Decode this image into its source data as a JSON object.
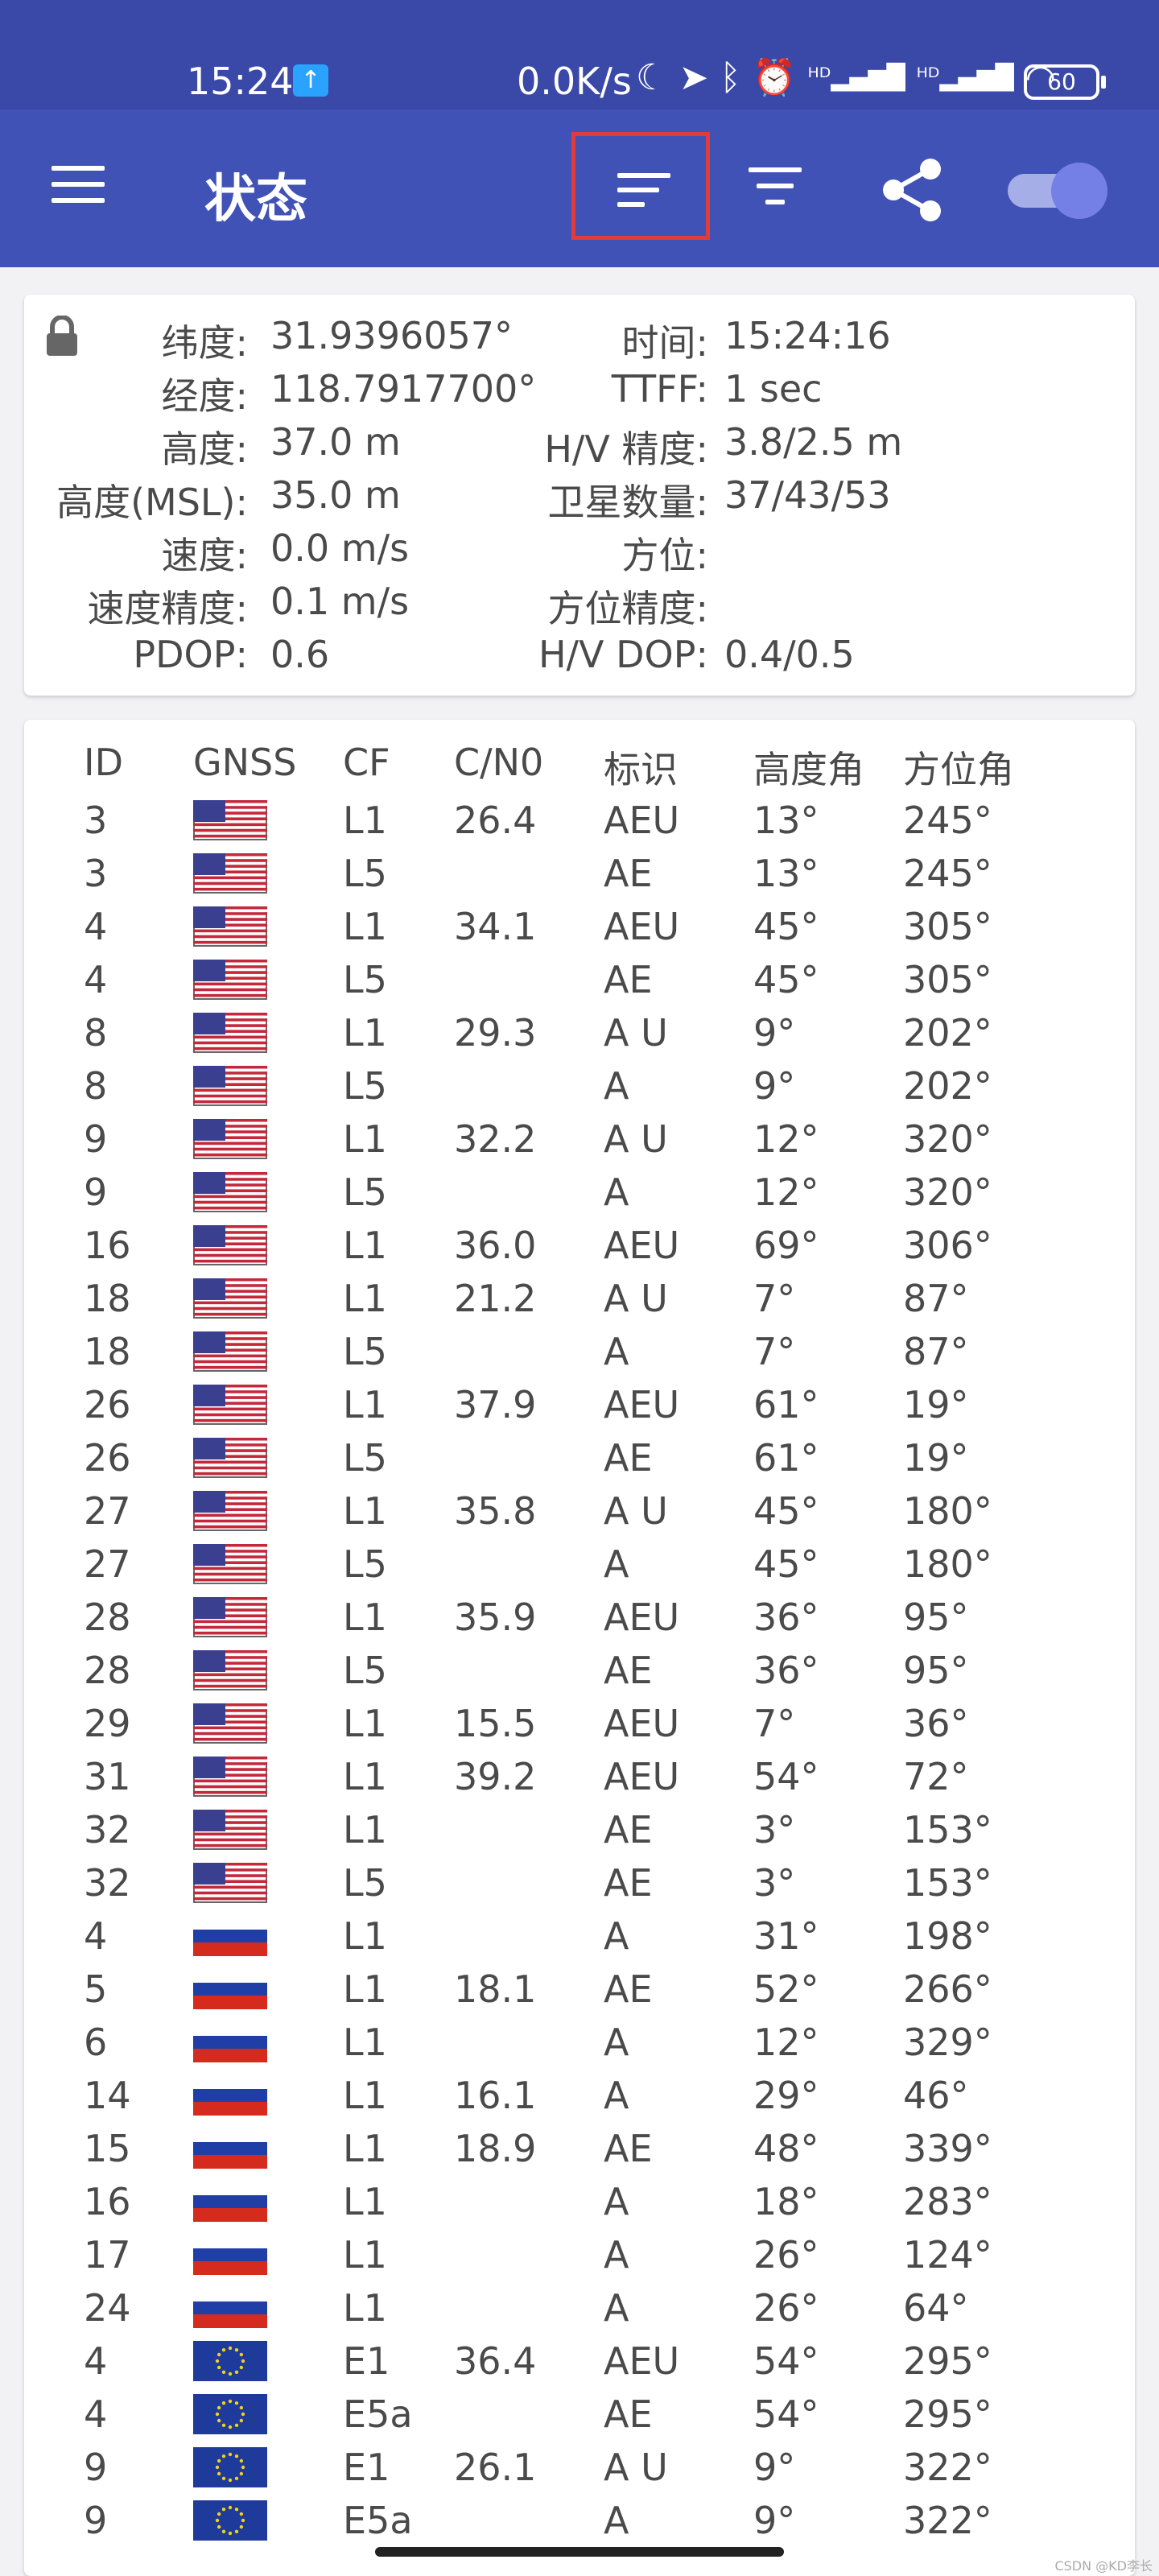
{
  "status_bar": {
    "time": "15:24",
    "speed": "0.0K/s",
    "battery": "60"
  },
  "appbar": {
    "title": "状态"
  },
  "info": {
    "rows": [
      {
        "l1": "纬度:",
        "v1": "31.9396057°",
        "l2": "时间:",
        "v2": "15:24:16"
      },
      {
        "l1": "经度:",
        "v1": "118.7917700°",
        "l2": "TTFF:",
        "v2": "1 sec"
      },
      {
        "l1": "高度:",
        "v1": "37.0 m",
        "l2": "H/V 精度:",
        "v2": "3.8/2.5 m"
      },
      {
        "l1": "高度(MSL):",
        "v1": "35.0 m",
        "l2": "卫星数量:",
        "v2": "37/43/53"
      },
      {
        "l1": "速度:",
        "v1": "0.0 m/s",
        "l2": "方位:",
        "v2": ""
      },
      {
        "l1": "速度精度:",
        "v1": "0.1 m/s",
        "l2": "方位精度:",
        "v2": ""
      },
      {
        "l1": "PDOP:",
        "v1": "0.6",
        "l2": "H/V DOP:",
        "v2": "0.4/0.5"
      }
    ]
  },
  "table": {
    "headers": [
      "ID",
      "GNSS",
      "CF",
      "C/N0",
      "标识",
      "高度角",
      "方位角"
    ],
    "rows": [
      {
        "id": "3",
        "flag": "us",
        "cf": "L1",
        "cn0": "26.4",
        "flags": "AEU",
        "elev": "13°",
        "azim": "245°"
      },
      {
        "id": "3",
        "flag": "us",
        "cf": "L5",
        "cn0": "",
        "flags": "AE",
        "elev": "13°",
        "azim": "245°"
      },
      {
        "id": "4",
        "flag": "us",
        "cf": "L1",
        "cn0": "34.1",
        "flags": "AEU",
        "elev": "45°",
        "azim": "305°"
      },
      {
        "id": "4",
        "flag": "us",
        "cf": "L5",
        "cn0": "",
        "flags": "AE",
        "elev": "45°",
        "azim": "305°"
      },
      {
        "id": "8",
        "flag": "us",
        "cf": "L1",
        "cn0": "29.3",
        "flags": "A U",
        "elev": "9°",
        "azim": "202°"
      },
      {
        "id": "8",
        "flag": "us",
        "cf": "L5",
        "cn0": "",
        "flags": "A",
        "elev": "9°",
        "azim": "202°"
      },
      {
        "id": "9",
        "flag": "us",
        "cf": "L1",
        "cn0": "32.2",
        "flags": "A U",
        "elev": "12°",
        "azim": "320°"
      },
      {
        "id": "9",
        "flag": "us",
        "cf": "L5",
        "cn0": "",
        "flags": "A",
        "elev": "12°",
        "azim": "320°"
      },
      {
        "id": "16",
        "flag": "us",
        "cf": "L1",
        "cn0": "36.0",
        "flags": "AEU",
        "elev": "69°",
        "azim": "306°"
      },
      {
        "id": "18",
        "flag": "us",
        "cf": "L1",
        "cn0": "21.2",
        "flags": "A U",
        "elev": "7°",
        "azim": "87°"
      },
      {
        "id": "18",
        "flag": "us",
        "cf": "L5",
        "cn0": "",
        "flags": "A",
        "elev": "7°",
        "azim": "87°"
      },
      {
        "id": "26",
        "flag": "us",
        "cf": "L1",
        "cn0": "37.9",
        "flags": "AEU",
        "elev": "61°",
        "azim": "19°"
      },
      {
        "id": "26",
        "flag": "us",
        "cf": "L5",
        "cn0": "",
        "flags": "AE",
        "elev": "61°",
        "azim": "19°"
      },
      {
        "id": "27",
        "flag": "us",
        "cf": "L1",
        "cn0": "35.8",
        "flags": "A U",
        "elev": "45°",
        "azim": "180°"
      },
      {
        "id": "27",
        "flag": "us",
        "cf": "L5",
        "cn0": "",
        "flags": "A",
        "elev": "45°",
        "azim": "180°"
      },
      {
        "id": "28",
        "flag": "us",
        "cf": "L1",
        "cn0": "35.9",
        "flags": "AEU",
        "elev": "36°",
        "azim": "95°"
      },
      {
        "id": "28",
        "flag": "us",
        "cf": "L5",
        "cn0": "",
        "flags": "AE",
        "elev": "36°",
        "azim": "95°"
      },
      {
        "id": "29",
        "flag": "us",
        "cf": "L1",
        "cn0": "15.5",
        "flags": "AEU",
        "elev": "7°",
        "azim": "36°"
      },
      {
        "id": "31",
        "flag": "us",
        "cf": "L1",
        "cn0": "39.2",
        "flags": "AEU",
        "elev": "54°",
        "azim": "72°"
      },
      {
        "id": "32",
        "flag": "us",
        "cf": "L1",
        "cn0": "",
        "flags": "AE",
        "elev": "3°",
        "azim": "153°"
      },
      {
        "id": "32",
        "flag": "us",
        "cf": "L5",
        "cn0": "",
        "flags": "AE",
        "elev": "3°",
        "azim": "153°"
      },
      {
        "id": "4",
        "flag": "ru",
        "cf": "L1",
        "cn0": "",
        "flags": "A",
        "elev": "31°",
        "azim": "198°"
      },
      {
        "id": "5",
        "flag": "ru",
        "cf": "L1",
        "cn0": "18.1",
        "flags": "AE",
        "elev": "52°",
        "azim": "266°"
      },
      {
        "id": "6",
        "flag": "ru",
        "cf": "L1",
        "cn0": "",
        "flags": "A",
        "elev": "12°",
        "azim": "329°"
      },
      {
        "id": "14",
        "flag": "ru",
        "cf": "L1",
        "cn0": "16.1",
        "flags": "A",
        "elev": "29°",
        "azim": "46°"
      },
      {
        "id": "15",
        "flag": "ru",
        "cf": "L1",
        "cn0": "18.9",
        "flags": "AE",
        "elev": "48°",
        "azim": "339°"
      },
      {
        "id": "16",
        "flag": "ru",
        "cf": "L1",
        "cn0": "",
        "flags": "A",
        "elev": "18°",
        "azim": "283°"
      },
      {
        "id": "17",
        "flag": "ru",
        "cf": "L1",
        "cn0": "",
        "flags": "A",
        "elev": "26°",
        "azim": "124°"
      },
      {
        "id": "24",
        "flag": "ru",
        "cf": "L1",
        "cn0": "",
        "flags": "A",
        "elev": "26°",
        "azim": "64°"
      },
      {
        "id": "4",
        "flag": "eu",
        "cf": "E1",
        "cn0": "36.4",
        "flags": "AEU",
        "elev": "54°",
        "azim": "295°"
      },
      {
        "id": "4",
        "flag": "eu",
        "cf": "E5a",
        "cn0": "",
        "flags": "AE",
        "elev": "54°",
        "azim": "295°"
      },
      {
        "id": "9",
        "flag": "eu",
        "cf": "E1",
        "cn0": "26.1",
        "flags": "A U",
        "elev": "9°",
        "azim": "322°"
      },
      {
        "id": "9",
        "flag": "eu",
        "cf": "E5a",
        "cn0": "",
        "flags": "A",
        "elev": "9°",
        "azim": "322°"
      }
    ]
  },
  "watermark": "CSDN @KD李长"
}
